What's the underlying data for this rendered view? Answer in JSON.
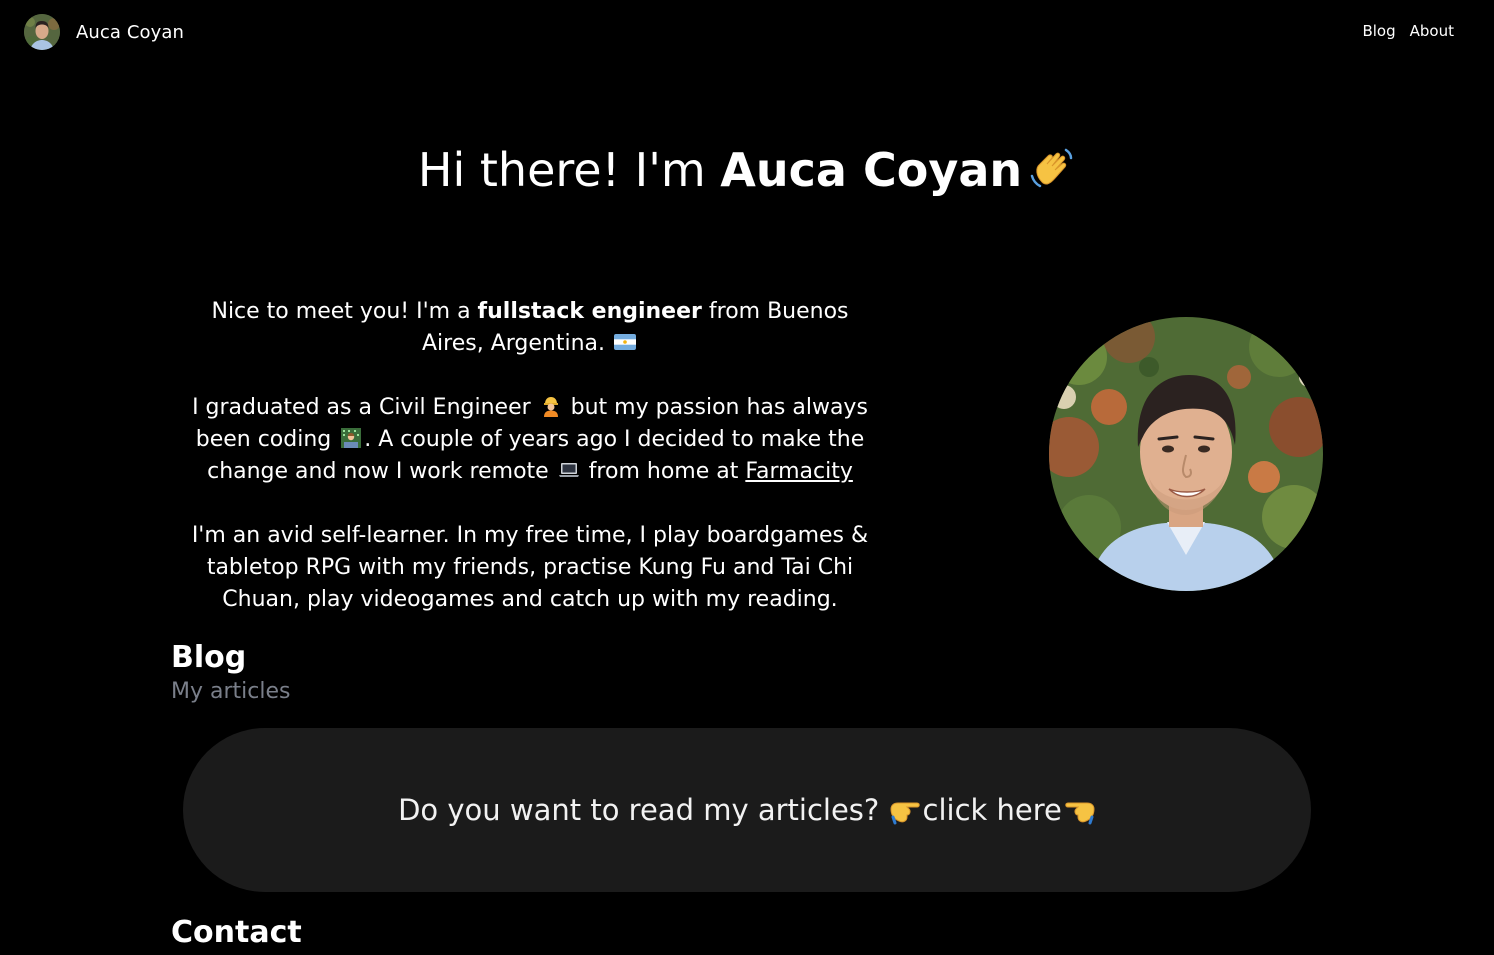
{
  "header": {
    "brand_name": "Auca Coyan",
    "nav": [
      {
        "label": "Blog"
      },
      {
        "label": "About"
      }
    ]
  },
  "hero": {
    "greeting": "Hi there! I'm ",
    "name": "Auca Coyan",
    "icon": "waving-hand-icon"
  },
  "intro": {
    "p1_a": "Nice to meet you! I'm a ",
    "p1_bold": "fullstack engineer",
    "p1_b": " from Buenos Aires, Argentina.",
    "p1_icon": "argentina-flag-icon",
    "p2_a": "I graduated as a Civil Engineer ",
    "p2_icon1": "construction-worker-icon",
    "p2_b": " but my passion has always been coding ",
    "p2_icon2": "technologist-icon",
    "p2_c": ". A couple of years ago I decided to make the change and now I work remote ",
    "p2_icon3": "laptop-icon",
    "p2_d": " from home at ",
    "p2_link": "Farmacity",
    "p3": "I'm an avid self-learner. In my free time, I play boardgames & tabletop RPG with my friends, practise Kung Fu and Tai Chi Chuan, play videogames and catch up with my reading."
  },
  "blog": {
    "title": "Blog",
    "subtitle": "My articles",
    "cta_text": "Do you want to read my articles? ",
    "cta_link": "click here",
    "icons": [
      "pointing-right-hand-icon",
      "pointing-left-hand-icon"
    ]
  },
  "contact": {
    "title": "Contact"
  },
  "colors": {
    "background": "#000000",
    "text": "#ffffff",
    "muted": "#7a7f8a",
    "card": "#1b1b1b"
  }
}
